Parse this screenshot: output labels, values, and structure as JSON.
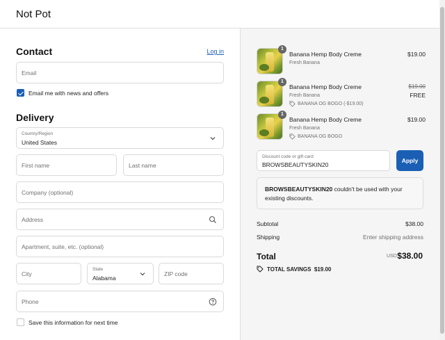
{
  "header": {
    "store_name": "Not Pot"
  },
  "contact": {
    "title": "Contact",
    "login_label": "Log in",
    "email_placeholder": "Email",
    "news_label": "Email me with news and offers",
    "news_checked": true
  },
  "delivery": {
    "title": "Delivery",
    "country_label": "Country/Region",
    "country_value": "United States",
    "first_name_placeholder": "First name",
    "last_name_placeholder": "Last name",
    "company_placeholder": "Company (optional)",
    "address_placeholder": "Address",
    "apartment_placeholder": "Apartment, suite, etc. (optional)",
    "city_placeholder": "City",
    "state_label": "State",
    "state_value": "Alabama",
    "zip_placeholder": "ZIP code",
    "phone_placeholder": "Phone",
    "save_info_label": "Save this information for next time",
    "save_info_checked": false
  },
  "cart": {
    "items": [
      {
        "qty": "1",
        "name": "Banana Hemp Body Creme",
        "variant": "Fresh Banana",
        "price": "$19.00"
      },
      {
        "qty": "1",
        "name": "Banana Hemp Body Creme",
        "variant": "Fresh Banana",
        "discount": "BANANA OG BOGO (-$19.00)",
        "old_price": "$19.00",
        "price": "FREE"
      },
      {
        "qty": "1",
        "name": "Banana Hemp Body Creme",
        "variant": "Fresh Banana",
        "discount": "BANANA OG BOGO",
        "price": "$19.00"
      }
    ],
    "discount_label": "Discount code or gift card",
    "discount_value": "BROWSBEAUTYSKIN20",
    "apply_label": "Apply",
    "error_code": "BROWSBEAUTYSKIN20",
    "error_message": " couldn't be used with your existing discounts.",
    "subtotal_label": "Subtotal",
    "subtotal_value": "$38.00",
    "shipping_label": "Shipping",
    "shipping_value": "Enter shipping address",
    "total_label": "Total",
    "total_currency": "USD",
    "total_value": "$38.00",
    "savings_label": "TOTAL SAVINGS",
    "savings_value": "$19.00"
  },
  "colors": {
    "accent": "#1a5fb4",
    "panel_bg": "#f5f5f5"
  }
}
